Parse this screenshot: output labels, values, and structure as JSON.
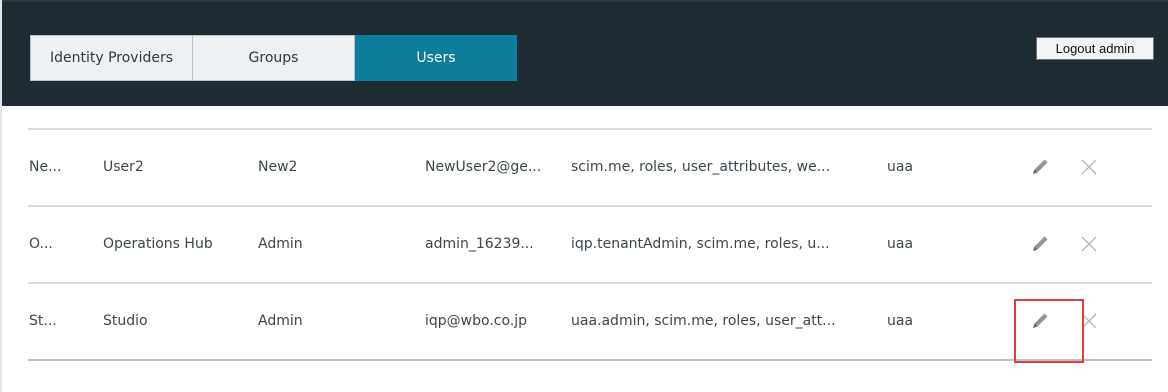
{
  "header": {
    "tabs": [
      {
        "label": "Identity Providers",
        "active": false
      },
      {
        "label": "Groups",
        "active": false
      },
      {
        "label": "Users",
        "active": true
      }
    ],
    "logout_label": "Logout admin"
  },
  "colors": {
    "header_bg": "#1e2b33",
    "active_tab": "#0d7d9c",
    "highlight": "#e23b3b"
  },
  "users": {
    "rows": [
      {
        "first": "Ne...",
        "last": "User2",
        "name": "New2",
        "email": "NewUser2@ge...",
        "scopes": "scim.me, roles, user_attributes, we...",
        "origin": "uaa",
        "edit_icon": "pencil-icon",
        "delete_icon": "close-icon"
      },
      {
        "first": "O...",
        "last": "Operations Hub",
        "name": "Admin",
        "email": "admin_16239...",
        "scopes": "iqp.tenantAdmin, scim.me, roles, u...",
        "origin": "uaa",
        "edit_icon": "pencil-icon",
        "delete_icon": "close-icon"
      },
      {
        "first": "St...",
        "last": "Studio",
        "name": "Admin",
        "email": "iqp@wbo.co.jp",
        "scopes": "uaa.admin, scim.me, roles, user_att...",
        "origin": "uaa",
        "edit_icon": "pencil-icon",
        "delete_icon": "close-icon",
        "highlighted": "edit"
      }
    ]
  }
}
